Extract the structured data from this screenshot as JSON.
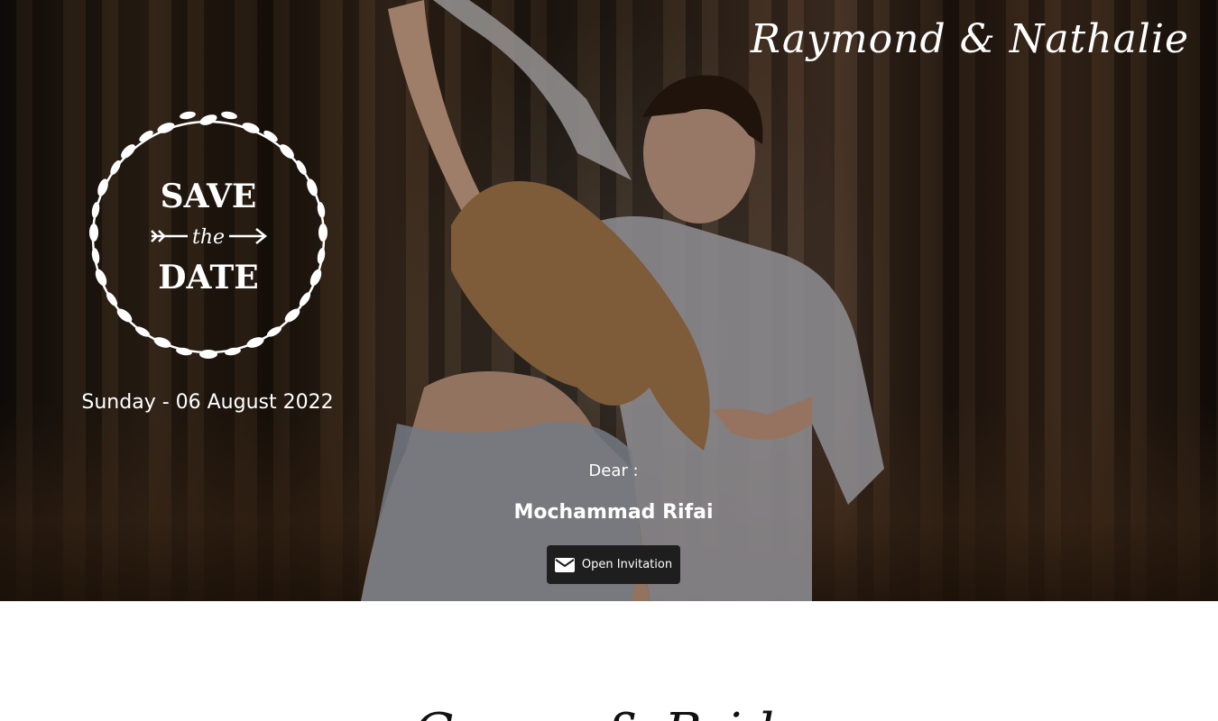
{
  "header": {
    "couple_names": "Raymond & Nathalie"
  },
  "badge": {
    "line1": "SAVE",
    "line2": "the",
    "line3": "DATE"
  },
  "event": {
    "date_text": "Sunday - 06 August 2022"
  },
  "invite": {
    "greeting": "Dear :",
    "guest_name": "Mochammad Rifai",
    "open_button_label": "Open Invitation",
    "open_button_icon": "mail-icon"
  },
  "section": {
    "title": "Groom & Bride"
  }
}
